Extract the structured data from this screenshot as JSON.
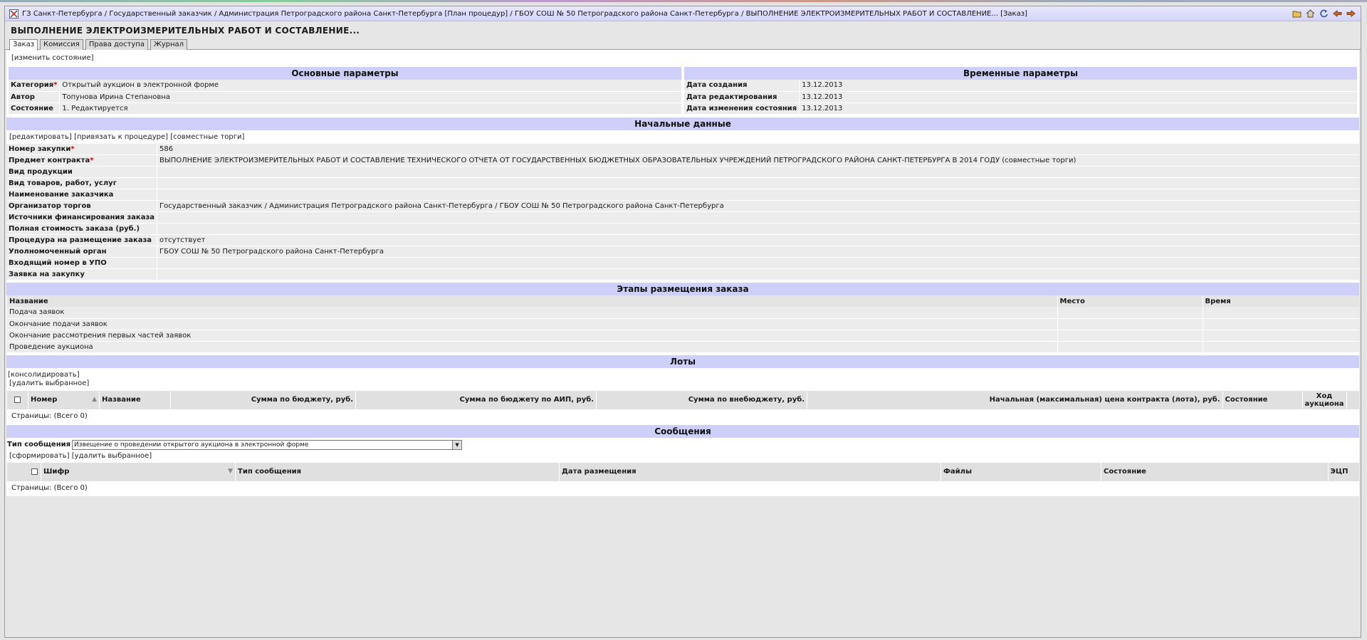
{
  "titlebar": {
    "breadcrumb": "ГЗ Санкт-Петербурга / Государственный заказчик / Администрация Петроградского района Санкт-Петербурга [План процедур] / ГБОУ СОШ № 50 Петроградского района Санкт-Петербурга / ВЫПОЛНЕНИЕ ЭЛЕКТРОИЗМЕРИТЕЛЬНЫХ РАБОТ И СОСТАВЛЕНИЕ... [Заказ]",
    "tools": [
      "open-folder-icon",
      "home-icon",
      "refresh-icon",
      "back-arrow-icon",
      "forward-arrow-icon"
    ]
  },
  "page_title": "ВЫПОЛНЕНИЕ ЭЛЕКТРОИЗМЕРИТЕЛЬНЫХ РАБОТ И СОСТАВЛЕНИЕ...",
  "tabs": [
    {
      "label": "Заказ"
    },
    {
      "label": "Комиссия"
    },
    {
      "label": "Права доступа"
    },
    {
      "label": "Журнал"
    }
  ],
  "change_state_link": "[изменить состояние]",
  "basic": {
    "title": "Основные параметры",
    "rows": [
      {
        "label": "Категория",
        "value": "Открытый аукцион в электронной форме",
        "required": "*"
      },
      {
        "label": "Автор",
        "value": "Топунова Ирина Степановна"
      },
      {
        "label": "Состояние",
        "value": "1. Редактируется"
      }
    ]
  },
  "time": {
    "title": "Временные параметры",
    "rows": [
      {
        "label": "Дата создания",
        "value": "13.12.2013"
      },
      {
        "label": "Дата редактирования",
        "value": "13.12.2013"
      },
      {
        "label": "Дата изменения состояния",
        "value": "13.12.2013"
      }
    ]
  },
  "initial": {
    "title": "Начальные данные",
    "links": {
      "edit": "[редактировать]",
      "attach": "[привязать к процедуре]",
      "joint": "[совместные торги]"
    },
    "rows": [
      {
        "label": "Номер закупки",
        "value": "586",
        "required": "*"
      },
      {
        "label": "Предмет контракта",
        "value": "ВЫПОЛНЕНИЕ ЭЛЕКТРОИЗМЕРИТЕЛЬНЫХ РАБОТ И СОСТАВЛЕНИЕ ТЕХНИЧЕСКОГО ОТЧЕТА ОТ ГОСУДАРСТВЕННЫХ БЮДЖЕТНЫХ ОБРАЗОВАТЕЛЬНЫХ УЧРЕЖДЕНИЙ ПЕТРОГРАДСКОГО РАЙОНА САНКТ-ПЕТЕРБУРГА В 2014 ГОДУ (совместные торги)",
        "required": "*"
      },
      {
        "label": "Вид продукции",
        "value": ""
      },
      {
        "label": "Вид товаров, работ, услуг",
        "value": ""
      },
      {
        "label": "Наименование заказчика",
        "value": ""
      },
      {
        "label": "Организатор торгов",
        "value": "Государственный заказчик / Администрация Петроградского района Санкт-Петербурга / ГБОУ СОШ № 50 Петроградского района Санкт-Петербурга"
      },
      {
        "label": "Источники финансирования заказа",
        "value": ""
      },
      {
        "label": "Полная стоимость заказа (руб.)",
        "value": ""
      },
      {
        "label": "Процедура на размещение заказа",
        "value": "отсутствует"
      },
      {
        "label": "Уполномоченный орган",
        "value": "ГБОУ СОШ № 50 Петроградского района Санкт-Петербурга"
      },
      {
        "label": "Входящий номер в УПО",
        "value": ""
      },
      {
        "label": "Заявка на закупку",
        "value": ""
      }
    ]
  },
  "stages": {
    "title": "Этапы размещения заказа",
    "headers": {
      "name": "Название",
      "place": "Место",
      "time": "Время"
    },
    "rows": [
      {
        "name": "Подача заявок"
      },
      {
        "name": "Окончание подачи заявок"
      },
      {
        "name": "Окончание рассмотрения первых частей заявок"
      },
      {
        "name": "Проведение аукциона"
      }
    ]
  },
  "lots": {
    "title": "Лоты",
    "consolidate": "[консолидировать]",
    "delete_selected": "[удалить выбранное]",
    "headers": {
      "number": "Номер",
      "name": "Название",
      "budget": "Сумма по бюджету, руб.",
      "budget_aip": "Сумма по бюджету по АИП, руб.",
      "offbudget": "Сумма по внебюджету, руб.",
      "max_price": "Начальная (максимальная) цена контракта (лота), руб.",
      "state": "Состояние",
      "auction_line1": "Ход",
      "auction_line2": "аукциона"
    },
    "pager": "Страницы: (Всего 0)"
  },
  "messages": {
    "title": "Сообщения",
    "type_label": "Тип сообщения",
    "type_value": "Извещение о проведении открытого аукциона в электронной форме",
    "form": "[сформировать]",
    "delete_selected": "[удалить выбранное]",
    "headers": {
      "cipher": "Шифр",
      "type": "Тип сообщения",
      "date": "Дата размещения",
      "files": "Файлы",
      "state": "Состояние",
      "ecp": "ЭЦП"
    },
    "pager": "Страницы: (Всего 0)"
  }
}
